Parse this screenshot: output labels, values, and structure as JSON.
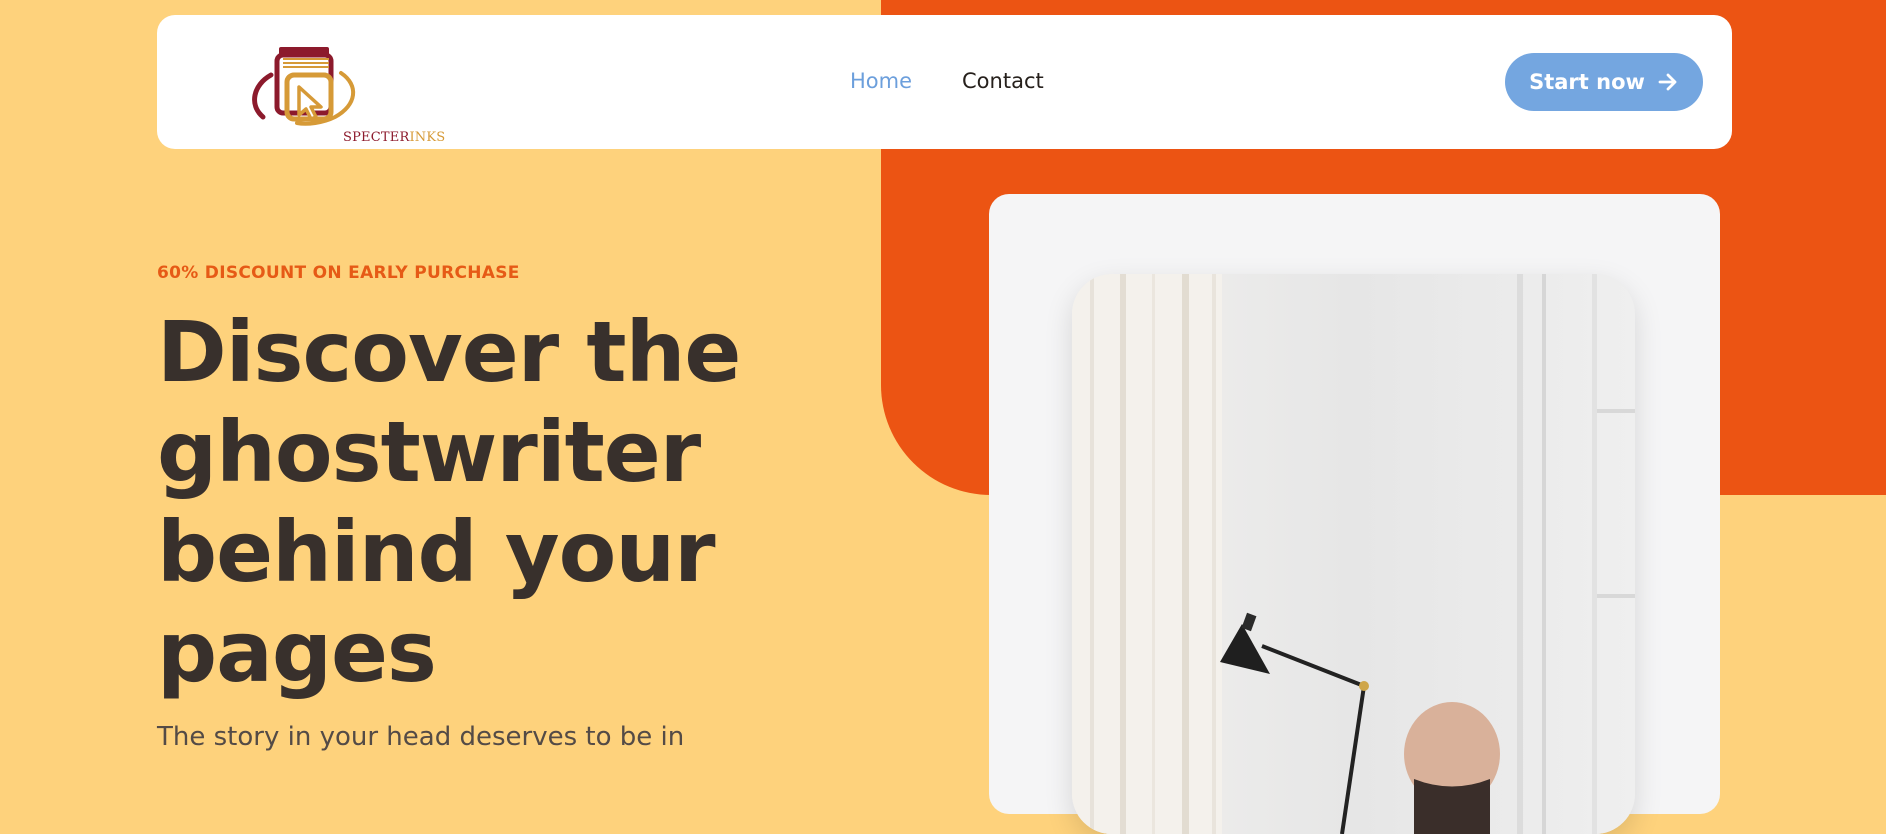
{
  "brand": {
    "name_part1": "SPECTER",
    "name_part2": "INKS",
    "colors": {
      "maroon": "#8c1a2c",
      "gold": "#d69a37"
    }
  },
  "nav": {
    "links": [
      {
        "label": "Home",
        "active": true
      },
      {
        "label": "Contact",
        "active": false
      }
    ],
    "cta_label": "Start now",
    "cta_icon": "arrow-right-icon"
  },
  "hero": {
    "eyebrow": "60% DISCOUNT ON EARLY PURCHASE",
    "headline": "Discover the ghostwriter behind your pages",
    "subtext": "The story in your head deserves to be in"
  },
  "colors": {
    "background": "#fed27c",
    "accent_orange": "#ec5413",
    "cta_blue": "#74a6e0",
    "text_dark": "#38302c",
    "eyebrow": "#e65a16"
  },
  "image": {
    "icon": "writer-at-desk-photo"
  }
}
